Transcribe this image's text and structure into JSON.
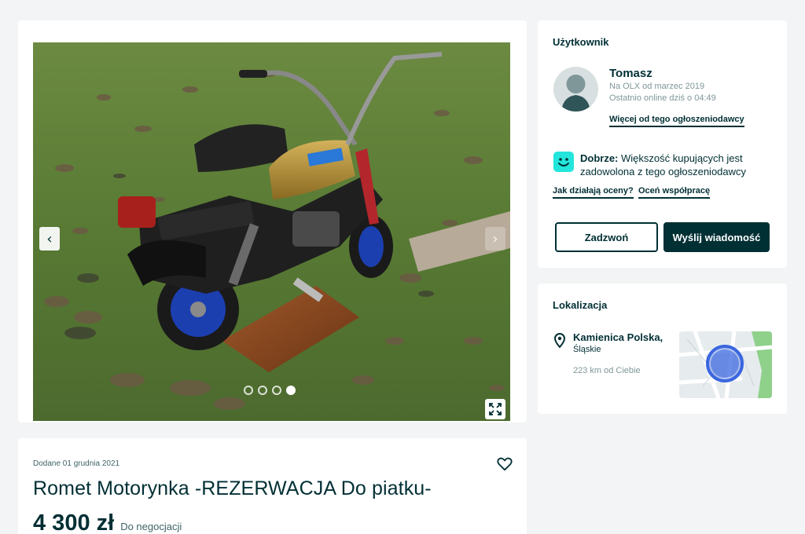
{
  "gallery": {
    "photo_alt": "Romet Motorynka",
    "image_count": 4,
    "active_image": 4,
    "prev_icon": "chevron-left-icon",
    "next_icon": "chevron-right-icon",
    "fullscreen_icon": "expand-icon"
  },
  "listing": {
    "added_date": "Dodane 01 grudnia 2021",
    "title": "Romet Motorynka -REZERWACJA Do piatku-",
    "price": "4 300 zł",
    "negotiable": "Do negocjacji",
    "favorite_icon": "heart-icon"
  },
  "user": {
    "heading": "Użytkownik",
    "name": "Tomasz",
    "member_since": "Na OLX od marzec 2019",
    "last_online": "Ostatnio online dziś o 04:49",
    "more_from_seller": "Więcej od tego ogłoszeniodawcy",
    "rating_label": "Dobrze:",
    "rating_text": "Większość kupujących jest zadowolona z tego ogłoszeniodawcy",
    "how_ratings_work": "Jak działają oceny?",
    "rate_cooperation": "Oceń współpracę",
    "call_button": "Zadzwoń",
    "message_button": "Wyślij wiadomość"
  },
  "location": {
    "heading": "Lokalizacja",
    "city": "Kamienica Polska,",
    "region": "Śląskie",
    "distance": "223 km od Ciebie"
  },
  "colors": {
    "primary": "#002f34",
    "rating_accent": "#23e5db",
    "map_marker": "#3a66e0",
    "background": "#f2f4f5"
  }
}
